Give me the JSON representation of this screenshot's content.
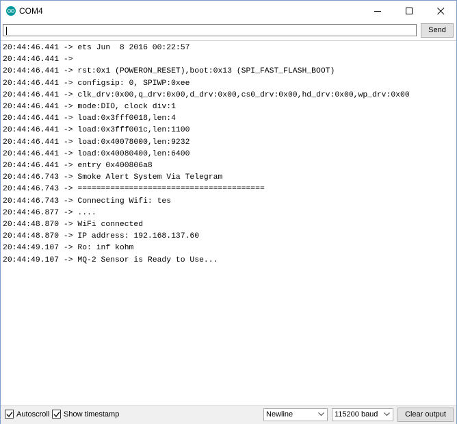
{
  "window": {
    "title": "COM4",
    "icon": "arduino-icon",
    "accent": "#00979d"
  },
  "input": {
    "value": "",
    "send_label": "Send"
  },
  "output": {
    "lines": [
      "20:44:46.441 -> ets Jun  8 2016 00:22:57",
      "20:44:46.441 -> ",
      "20:44:46.441 -> rst:0x1 (POWERON_RESET),boot:0x13 (SPI_FAST_FLASH_BOOT)",
      "20:44:46.441 -> configsip: 0, SPIWP:0xee",
      "20:44:46.441 -> clk_drv:0x00,q_drv:0x00,d_drv:0x00,cs0_drv:0x00,hd_drv:0x00,wp_drv:0x00",
      "20:44:46.441 -> mode:DIO, clock div:1",
      "20:44:46.441 -> load:0x3fff0018,len:4",
      "20:44:46.441 -> load:0x3fff001c,len:1100",
      "20:44:46.441 -> load:0x40078000,len:9232",
      "20:44:46.441 -> load:0x40080400,len:6400",
      "20:44:46.441 -> entry 0x400806a8",
      "20:44:46.743 -> Smoke Alert System Via Telegram",
      "20:44:46.743 -> ========================================",
      "20:44:46.743 -> Connecting Wifi: tes",
      "20:44:46.877 -> ....",
      "20:44:48.870 -> WiFi connected",
      "20:44:48.870 -> IP address: 192.168.137.60",
      "20:44:49.107 -> Ro: inf kohm",
      "20:44:49.107 -> MQ-2 Sensor is Ready to Use..."
    ]
  },
  "footer": {
    "autoscroll_label": "Autoscroll",
    "autoscroll_checked": true,
    "timestamp_label": "Show timestamp",
    "timestamp_checked": true,
    "line_ending": "Newline",
    "baud": "115200 baud",
    "clear_label": "Clear output"
  }
}
